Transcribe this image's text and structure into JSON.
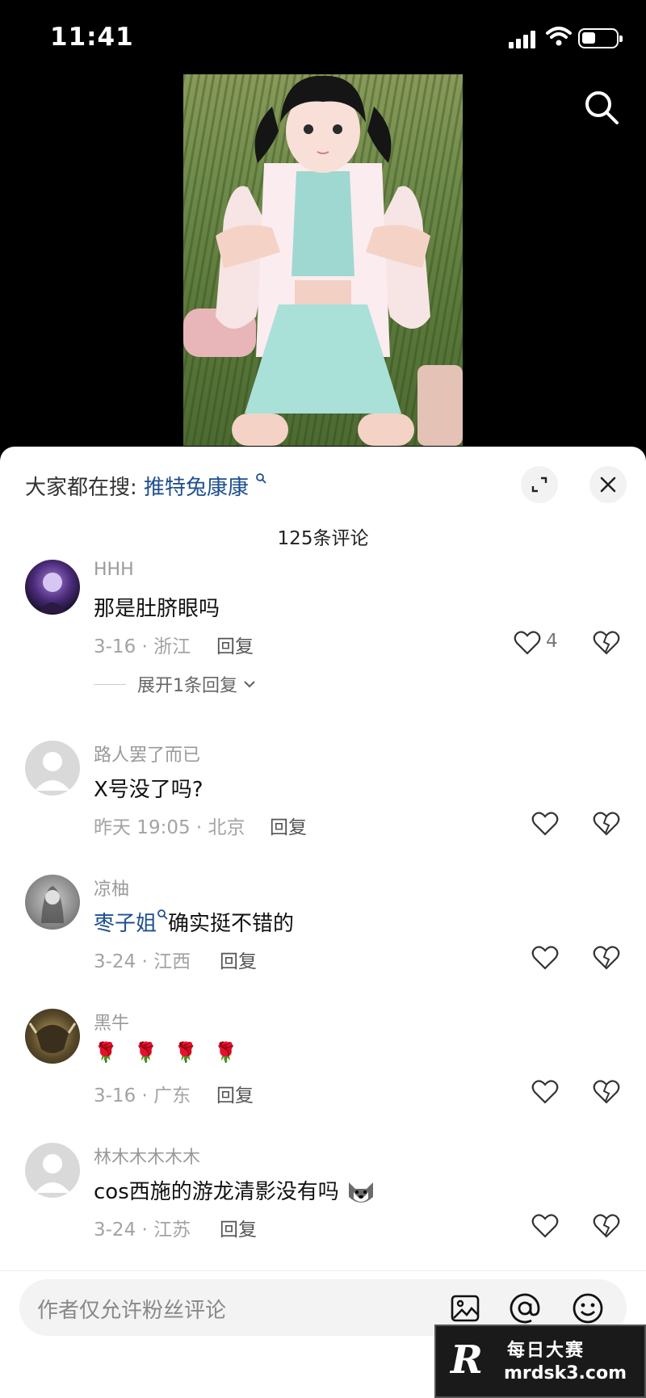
{
  "status_bar": {
    "time": "11:41",
    "battery_level": 0.3
  },
  "header": {
    "hot_search_prefix": "大家都在搜:",
    "hot_search_term": "推特兔康康"
  },
  "comment_count": "125条评论",
  "comments": [
    {
      "user": "HHH",
      "text": "那是肚脐眼吗",
      "meta": "3-16 · 浙江",
      "reply": "回复",
      "likes": "4",
      "expand": "展开1条回复"
    },
    {
      "user": "路人罢了而已",
      "text": "X号没了吗?",
      "meta": "昨天 19:05 · 北京",
      "reply": "回复",
      "likes": ""
    },
    {
      "user": "凉柚",
      "text_link": "枣子姐",
      "text": "确实挺不错的",
      "meta": "3-24 · 江西",
      "reply": "回复",
      "likes": ""
    },
    {
      "user": "黑牛",
      "text": "🌹 🌹 🌹 🌹",
      "meta": "3-16 · 广东",
      "reply": "回复",
      "likes": ""
    },
    {
      "user": "林木木木木木",
      "text": "cos西施的游龙清影没有吗",
      "meta": "3-24 · 江苏",
      "reply": "回复",
      "likes": ""
    }
  ],
  "input": {
    "placeholder": "作者仅允许粉丝评论"
  },
  "icons": [
    "signal-icon",
    "wifi-icon",
    "battery-icon",
    "search-icon",
    "expand-icon",
    "close-icon",
    "heart-icon",
    "broken-heart-icon",
    "image-icon",
    "at-icon",
    "emoji-icon"
  ],
  "watermark": {
    "logo": "R",
    "title": "每日大赛",
    "url": "mrdsk3.com"
  }
}
